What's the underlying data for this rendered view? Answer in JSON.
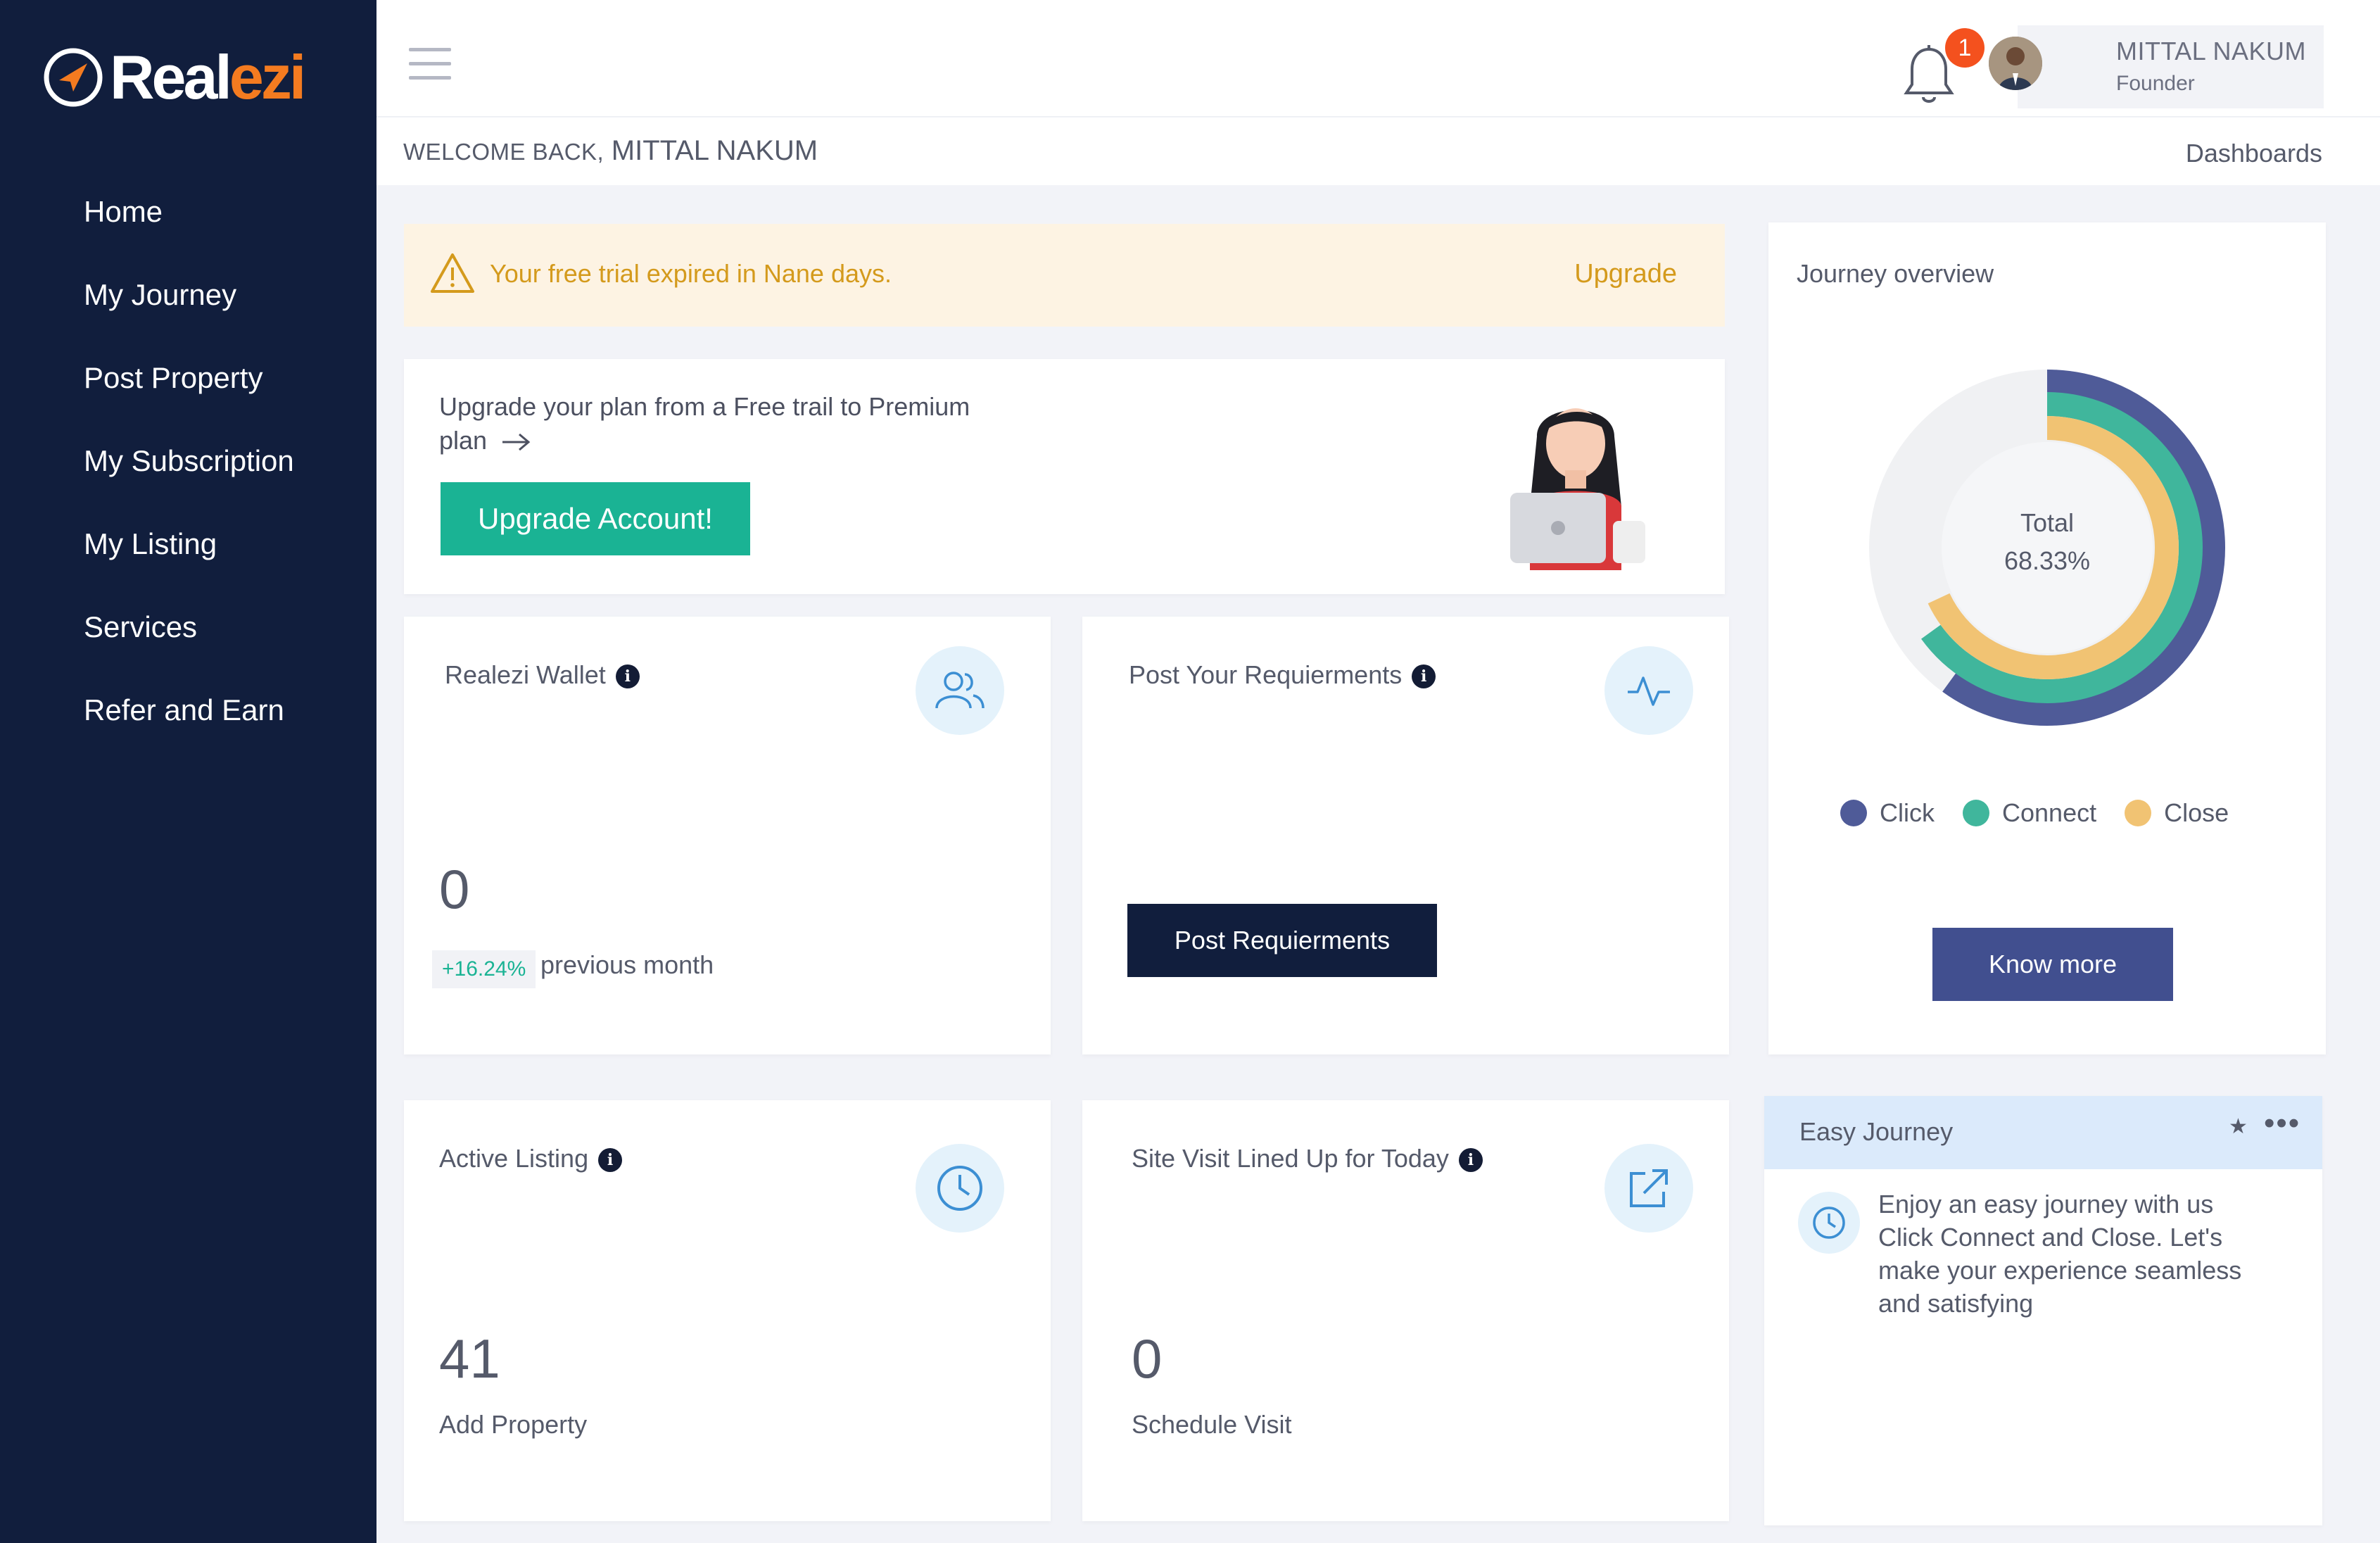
{
  "brand": {
    "name_part1": "Real",
    "name_part2": "ezi",
    "accent": "#f47b20",
    "sidebar_bg": "#111e3d"
  },
  "sidebar": {
    "items": [
      {
        "label": "Home"
      },
      {
        "label": "My Journey"
      },
      {
        "label": "Post Property"
      },
      {
        "label": "My Subscription"
      },
      {
        "label": "My Listing"
      },
      {
        "label": "Services"
      },
      {
        "label": "Refer and Earn"
      }
    ]
  },
  "header": {
    "notification_count": "1",
    "user_name": "MITTAL NAKUM",
    "user_role": "Founder",
    "icons": [
      "menu-icon",
      "bell-icon"
    ]
  },
  "subheader": {
    "welcome_label": "WELCOME BACK,",
    "welcome_name": "MITTAL NAKUM",
    "breadcrumb": "Dashboards"
  },
  "alert": {
    "text": "Your free trial expired in Nane days.",
    "link": "Upgrade",
    "color": "#d49a1c"
  },
  "upgrade": {
    "text": "Upgrade your plan from a Free trail to Premium plan",
    "button": "Upgrade Account!",
    "button_color": "#1ab394"
  },
  "wallet": {
    "title": "Realezi Wallet",
    "info": "i",
    "value": "0",
    "change": "+16.24%",
    "change_label": "previous month",
    "icon": "users-icon"
  },
  "post_requirements": {
    "title": "Post Your Requierments",
    "info": "i",
    "button": "Post Requierments",
    "icon": "activity-icon"
  },
  "journey": {
    "title": "Journey overview",
    "total_label": "Total",
    "total_value": "68.33%",
    "button": "Know more",
    "legend": [
      {
        "label": "Click",
        "color": "#4f5b98"
      },
      {
        "label": "Connect",
        "color": "#40b69c"
      },
      {
        "label": "Close",
        "color": "#f1c373"
      }
    ]
  },
  "chart_data": {
    "type": "pie",
    "subtype": "radial-rings",
    "center_text": [
      "Total",
      "68.33%"
    ],
    "series": [
      {
        "name": "Click",
        "fraction": 0.6
      },
      {
        "name": "Connect",
        "fraction": 0.65
      },
      {
        "name": "Close",
        "fraction": 0.68
      }
    ]
  },
  "active_listing": {
    "title": "Active Listing",
    "info": "i",
    "value": "41",
    "label": "Add Property",
    "icon": "clock-icon"
  },
  "site_visit": {
    "title": "Site Visit Lined Up for Today",
    "info": "i",
    "value": "0",
    "label": "Schedule Visit",
    "icon": "external-link-icon"
  },
  "easy_journey": {
    "title": "Easy Journey",
    "star": "★",
    "more": "•••",
    "text": "Enjoy an easy journey with us Click Connect and Close. Let's make your experience seamless and satisfying"
  }
}
